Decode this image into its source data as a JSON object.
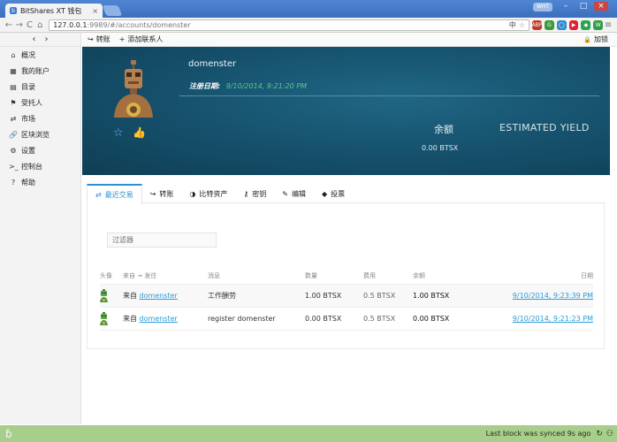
{
  "browser": {
    "tab_title": "BitShares XT 钱包",
    "tab_close": "×",
    "window_user": "WHT",
    "url_host": "127.0.0.1",
    "url_path": ":9989/#/accounts/domenster",
    "ime_indicator": "中",
    "nav": {
      "back": "←",
      "forward": "→",
      "reload": "C",
      "home": "⌂"
    },
    "window_buttons": {
      "minimize": "–",
      "maximize": "□",
      "close": "×"
    },
    "extensions": [
      {
        "label": "ABP",
        "color": "#c0392b"
      },
      {
        "label": "G",
        "color": "#3a9b3a"
      },
      {
        "label": "◯",
        "color": "#2e8ccf"
      },
      {
        "label": "▶",
        "color": "#d23"
      },
      {
        "label": "◆",
        "color": "#2aa64d"
      },
      {
        "label": "W",
        "color": "#2c9e47"
      }
    ]
  },
  "sidebar": {
    "back_arrow": "‹",
    "forward_arrow": "›",
    "items": [
      {
        "icon": "⌂",
        "label": "概况"
      },
      {
        "icon": "▦",
        "label": "我的账户"
      },
      {
        "icon": "▤",
        "label": "目录"
      },
      {
        "icon": "⚑",
        "label": "受托人"
      },
      {
        "icon": "⇄",
        "label": "市场"
      },
      {
        "icon": "🔗",
        "label": "区块浏览"
      },
      {
        "icon": "⚙",
        "label": "设置"
      },
      {
        "icon": ">_",
        "label": "控制台"
      },
      {
        "icon": "?",
        "label": "帮助"
      }
    ]
  },
  "appbar": {
    "transfer_icon": "↪",
    "transfer_label": "转账",
    "add_contact_icon": "+",
    "add_contact_label": "添加联系人",
    "lock_icon": "🔒",
    "lock_label": "加锁"
  },
  "account": {
    "name": "domenster",
    "registered_label": "注册日期",
    "registered_date": "9/10/2014, 9:21:20 PM",
    "balance_label": "余额",
    "balance_value": "0.00 BTSX",
    "yield_label": "ESTIMATED YIELD",
    "favorite_icon": "☆",
    "approve_icon": "👍"
  },
  "tabs": [
    {
      "icon": "⇄",
      "label": "最近交易"
    },
    {
      "icon": "↪",
      "label": "转账"
    },
    {
      "icon": "◑",
      "label": "比特资产"
    },
    {
      "icon": "⚷",
      "label": "密钥"
    },
    {
      "icon": "✎",
      "label": "编辑"
    },
    {
      "icon": "◆",
      "label": "投票"
    }
  ],
  "transactions": {
    "filter_placeholder": "过滤器",
    "columns": {
      "avatar": "头像",
      "from_to": "来自 ➞ 发往",
      "memo": "消息",
      "amount": "数量",
      "fee": "费用",
      "balance": "余额",
      "date": "日期"
    },
    "rows": [
      {
        "direction": "来自",
        "account": "domenster",
        "memo": "工作酬劳",
        "amount": "1.00 BTSX",
        "amount_color": "green",
        "fee": "0.5 BTSX",
        "balance": "1.00 BTSX",
        "date": "9/10/2014, 9:23:39 PM"
      },
      {
        "direction": "来自",
        "account": "domenster",
        "memo": "register domenster",
        "amount": "0.00 BTSX",
        "amount_color": "orange",
        "fee": "0.5 BTSX",
        "balance": "0.00 BTSX",
        "date": "9/10/2014, 9:21:23 PM"
      }
    ]
  },
  "status": {
    "sync_text": "Last block was synced 9s ago",
    "refresh_icon": "↻",
    "network_icon": "⚇"
  }
}
